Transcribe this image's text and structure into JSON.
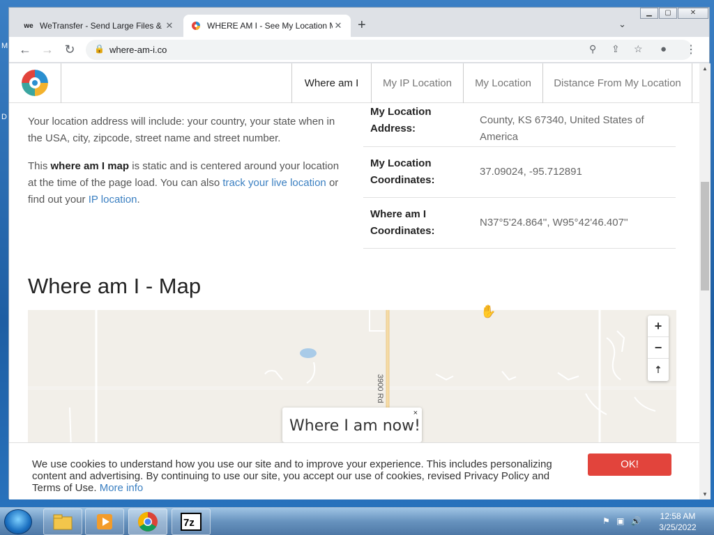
{
  "browser": {
    "tabs": [
      {
        "title": "WeTransfer - Send Large Files & ...",
        "favicon": "we"
      },
      {
        "title": "WHERE AM I - See My Location M...",
        "favicon": "wai"
      }
    ],
    "url": "where-am-i.co"
  },
  "site_nav": {
    "items": [
      "Where am I",
      "My IP Location",
      "My Location",
      "Distance From My Location"
    ],
    "active": "Where am I"
  },
  "left_text": {
    "para1": "Your location address will include: your country, your state when in the USA, city, zipcode, street name and street number.",
    "para2_a": "This ",
    "para2_b": "where am I map",
    "para2_c": " is static and is centered around your location at the time of the page load. You can also ",
    "para2_link1": "track your live location",
    "para2_d": " or find out your ",
    "para2_link2": "IP location",
    "para2_e": "."
  },
  "info_rows": [
    {
      "label": "My Location Address:",
      "value": "County, KS 67340, United States of America"
    },
    {
      "label": "My Location Coordinates:",
      "value": "37.09024, -95.712891"
    },
    {
      "label": "Where am I Coordinates:",
      "value": "N37°5'24.864'', W95°42'46.407''"
    }
  ],
  "map": {
    "title": "Where am I - Map",
    "road_label": "3900 Rd",
    "popup_text": "Where I am now!",
    "popup_close": "×",
    "zoom_in": "+",
    "zoom_out": "−",
    "reset": "⇡"
  },
  "cookie": {
    "text": "We use cookies to understand how you use our site and to improve your experience. This includes personalizing content and advertising. By continuing to use our site, you accept our use of cookies, revised Privacy Policy and Terms of Use.",
    "link": "More info",
    "button": "OK!"
  },
  "taskbar": {
    "time": "12:58 AM",
    "date": "3/25/2022"
  },
  "desktop": {
    "chars": [
      "M",
      "D"
    ]
  }
}
